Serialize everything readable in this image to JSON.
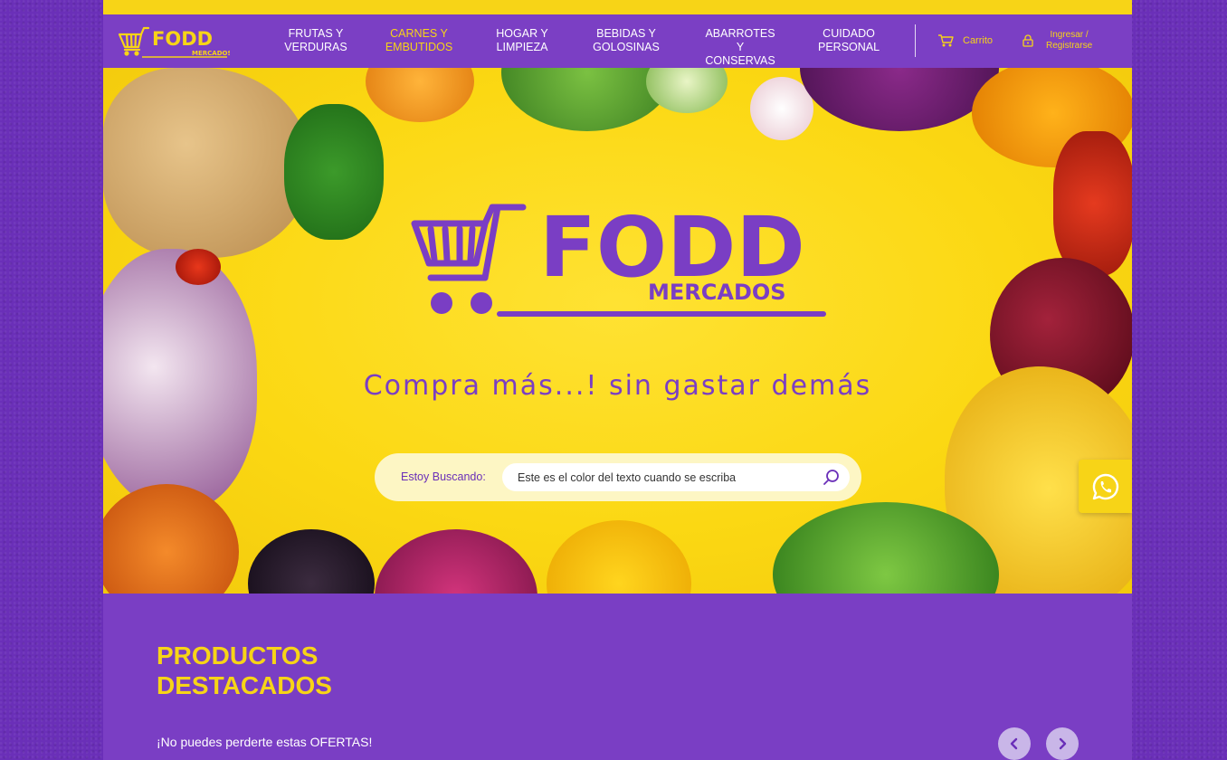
{
  "brand": {
    "name": "FODD",
    "sub": "MERCADOS"
  },
  "nav": {
    "items": [
      {
        "label": "FRUTAS Y\nVERDURAS",
        "active": false
      },
      {
        "label": "CARNES Y\nEMBUTIDOS",
        "active": true
      },
      {
        "label": "HOGAR Y\nLIMPIEZA",
        "active": false
      },
      {
        "label": "BEBIDAS Y\nGOLOSINAS",
        "active": false
      },
      {
        "label": "ABARROTES Y\nCONSERVAS",
        "active": false
      },
      {
        "label": "CUIDADO\nPERSONAL",
        "active": false
      }
    ],
    "cart_label": "Carrito",
    "login_label": "Ingresar /\nRegistrarse"
  },
  "hero": {
    "slogan": "Compra más...! sin gastar demás"
  },
  "search": {
    "label": "Estoy Buscando:",
    "value": "Este es el color del texto cuando se escriba"
  },
  "featured": {
    "title": "PRODUCTOS\nDESTACADOS",
    "subtitle": "¡No puedes perderte estas OFERTAS!"
  },
  "icons": {
    "cart": "cart-icon",
    "lock": "lock-icon",
    "search": "search-icon",
    "whatsapp": "whatsapp-icon",
    "prev": "chevron-left-icon",
    "next": "chevron-right-icon"
  },
  "colors": {
    "purple": "#7a3ec4",
    "yellow": "#f7d417",
    "background": "#6a2fb8"
  }
}
